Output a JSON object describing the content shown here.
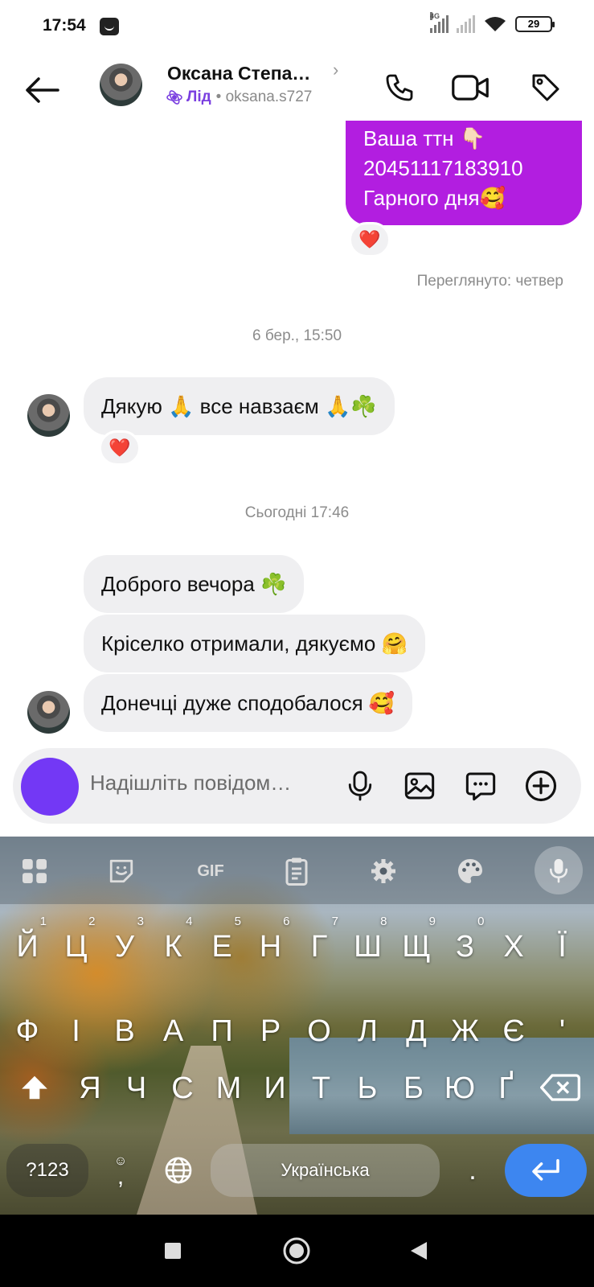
{
  "status_bar": {
    "time": "17:54",
    "network": "4G",
    "battery": "29"
  },
  "header": {
    "contact_name": "Оксана Степа…",
    "badge_label": "Лід",
    "username": "• oksana.s727"
  },
  "messages": {
    "outgoing": {
      "line1": "Ваша ттн 👇🏻",
      "line2": "20451117183910",
      "line3": "Гарного дня🥰",
      "reaction": "❤️"
    },
    "seen_text": "Переглянуто: четвер",
    "timestamp1": "6 бер., 15:50",
    "incoming1": {
      "text": "Дякую 🙏 все навзаєм 🙏☘️",
      "reaction": "❤️"
    },
    "timestamp2": "Сьогодні 17:46",
    "incoming2": "Доброго вечора ☘️",
    "incoming3": "Кріселко отримали, дякуємо 🤗",
    "incoming4": "Донечці дуже сподобалося 🥰"
  },
  "composer": {
    "placeholder": "Надішліть повідом…"
  },
  "keyboard": {
    "toolbar": {
      "gif": "GIF"
    },
    "row1": [
      {
        "k": "Й",
        "n": "1"
      },
      {
        "k": "Ц",
        "n": "2"
      },
      {
        "k": "У",
        "n": "3"
      },
      {
        "k": "К",
        "n": "4"
      },
      {
        "k": "Е",
        "n": "5"
      },
      {
        "k": "Н",
        "n": "6"
      },
      {
        "k": "Г",
        "n": "7"
      },
      {
        "k": "Ш",
        "n": "8"
      },
      {
        "k": "Щ",
        "n": "9"
      },
      {
        "k": "З",
        "n": "0"
      },
      {
        "k": "Х",
        "n": ""
      },
      {
        "k": "Ї",
        "n": ""
      }
    ],
    "row2": [
      "Ф",
      "І",
      "В",
      "А",
      "П",
      "Р",
      "О",
      "Л",
      "Д",
      "Ж",
      "Є",
      "'"
    ],
    "row3": [
      "Я",
      "Ч",
      "С",
      "М",
      "И",
      "Т",
      "Ь",
      "Б",
      "Ю",
      "Ґ"
    ],
    "symbols_label": "?123",
    "comma_label": ",",
    "space_label": "Українська",
    "period_label": "."
  }
}
